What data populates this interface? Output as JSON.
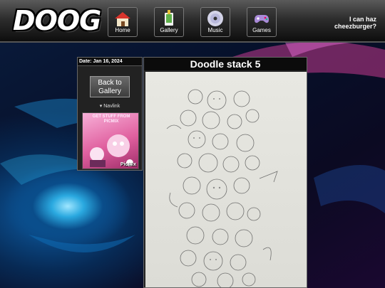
{
  "header": {
    "logo_text": "DOOG",
    "tagline": "I can haz cheezburger?",
    "nav": [
      {
        "label": "Home",
        "icon": "home-icon"
      },
      {
        "label": "Gallery",
        "icon": "gallery-icon"
      },
      {
        "label": "Music",
        "icon": "music-cd-icon"
      },
      {
        "label": "Games",
        "icon": "gamepad-icon"
      }
    ]
  },
  "sidebar": {
    "date": "Date: Jan 16, 2024",
    "back_button": "Back to Gallery",
    "navlink": "▾ Navlink",
    "ad_title": "GET STUFF FROM PICMIX",
    "ad_brand": "PicMix"
  },
  "main": {
    "title": "Doodle stack 5",
    "image_alt": "Pencil drawing of a tall stack of cartoon character doodles"
  },
  "colors": {
    "topbar": "#2e2e2e",
    "background": "#050814",
    "accent_blue": "#2aa9e0",
    "accent_pink": "#c23a8e"
  }
}
